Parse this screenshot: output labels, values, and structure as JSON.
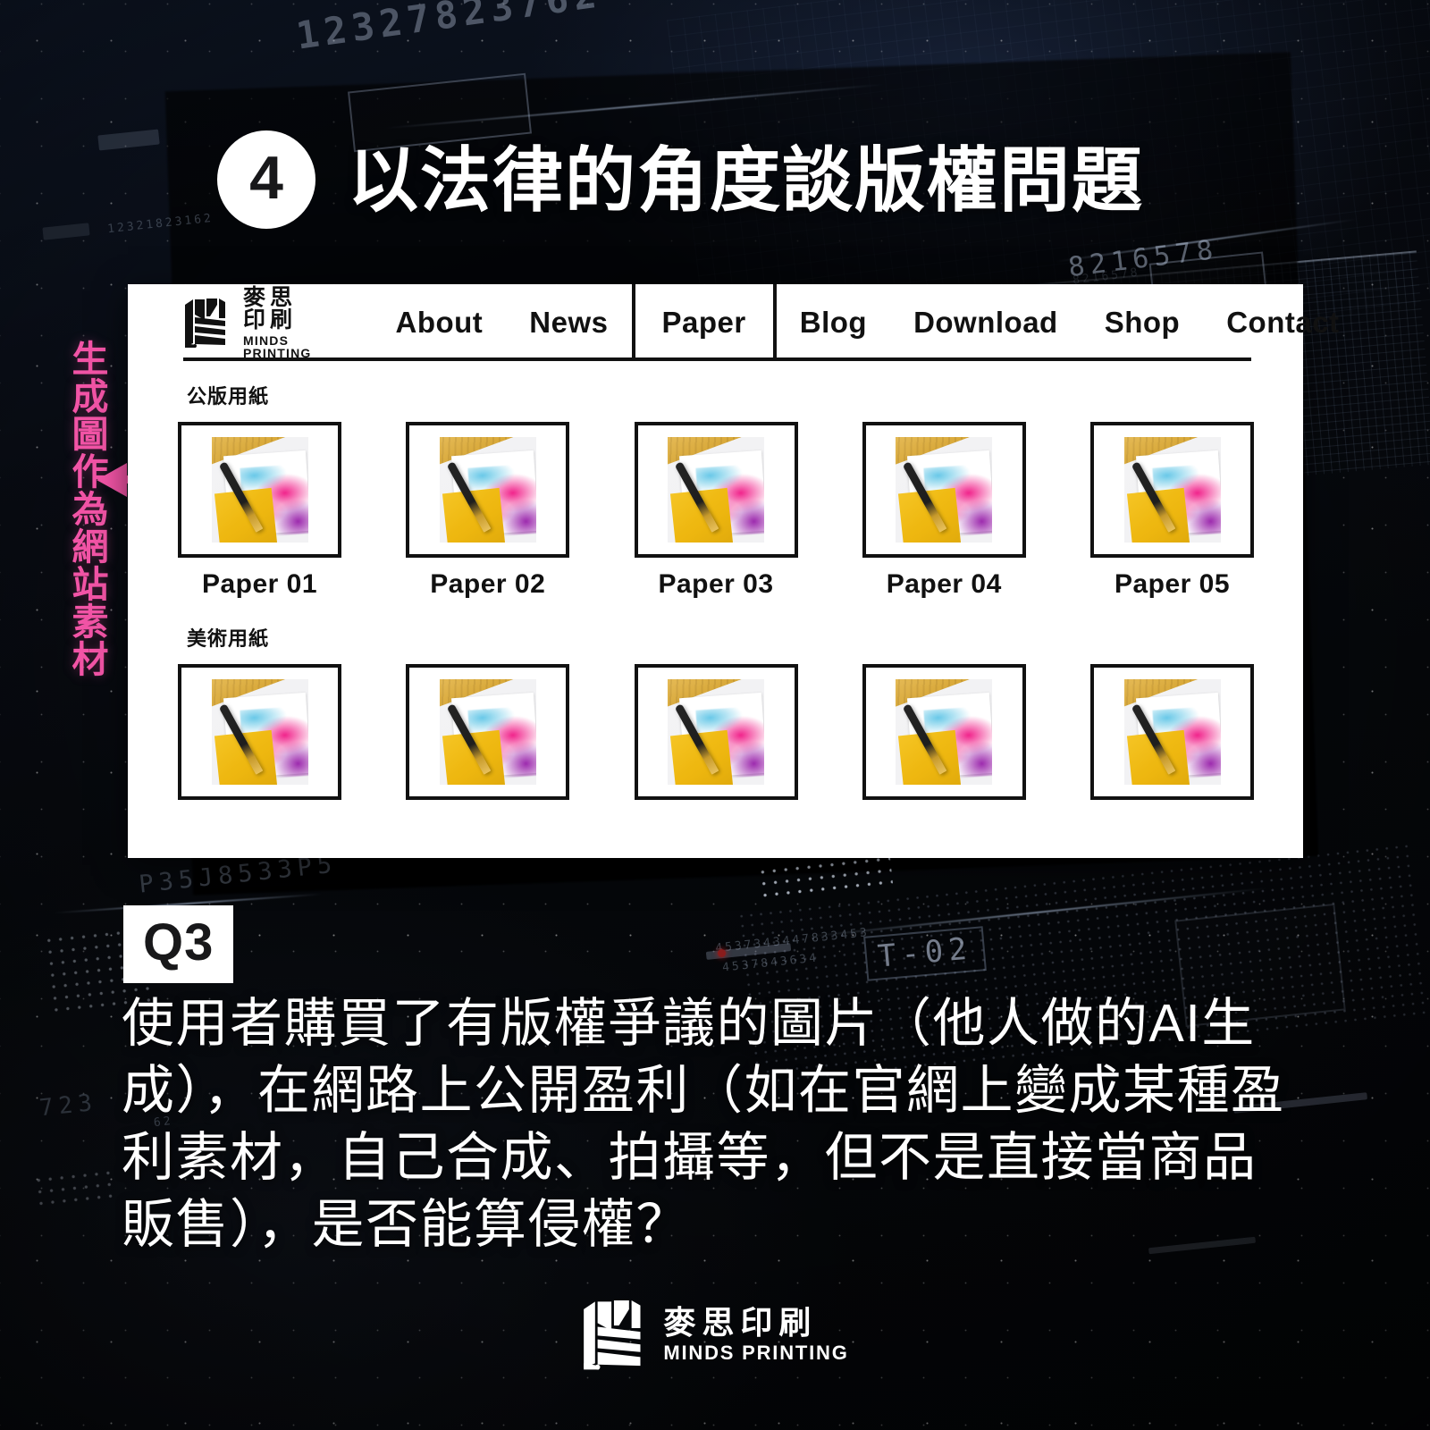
{
  "slide": {
    "number": "4",
    "title": "以法律的角度談版權問題"
  },
  "annotation": {
    "vertical_text": "生成圖作為網站素材",
    "arrow_color": "#f254a6"
  },
  "browser": {
    "brand": {
      "name_cn": "麥思印刷",
      "name_en": "MINDS PRINTING"
    },
    "nav": [
      {
        "label": "About",
        "active": false
      },
      {
        "label": "News",
        "active": false
      },
      {
        "label": "Paper",
        "active": true
      },
      {
        "label": "Blog",
        "active": false
      },
      {
        "label": "Download",
        "active": false
      },
      {
        "label": "Shop",
        "active": false
      },
      {
        "label": "Contact",
        "active": false
      }
    ],
    "sections": [
      {
        "label": "公版用紙",
        "show_captions": true,
        "items": [
          {
            "caption": "Paper 01"
          },
          {
            "caption": "Paper 02"
          },
          {
            "caption": "Paper 03"
          },
          {
            "caption": "Paper 04"
          },
          {
            "caption": "Paper 05"
          }
        ]
      },
      {
        "label": "美術用紙",
        "show_captions": false,
        "items": [
          {
            "caption": ""
          },
          {
            "caption": ""
          },
          {
            "caption": ""
          },
          {
            "caption": ""
          },
          {
            "caption": ""
          }
        ]
      }
    ]
  },
  "question": {
    "badge": "Q3",
    "text": "使用者購買了有版權爭議的圖片（他人做的AI生成），在網路上公開盈利（如在官網上變成某種盈利素材，自己合成、拍攝等，但不是直接當商品販售），是否能算侵權？"
  },
  "footer": {
    "name_cn": "麥思印刷",
    "name_en": "MINDS PRINTING"
  },
  "background": {
    "numbers_top": "12327823762",
    "numbers_top_faint": "12321823162",
    "numbers_right": "8216578",
    "numbers_left_mid": "P35J8533P5",
    "numbers_panel_a": "4537343447833453",
    "numbers_panel_b": "4537843634",
    "numbers_lowleft": "723",
    "numbers_lowleft2": "62",
    "terminal_code": "T-02",
    "base_color": "#05070a",
    "accent_color": "#cdd9ee"
  }
}
